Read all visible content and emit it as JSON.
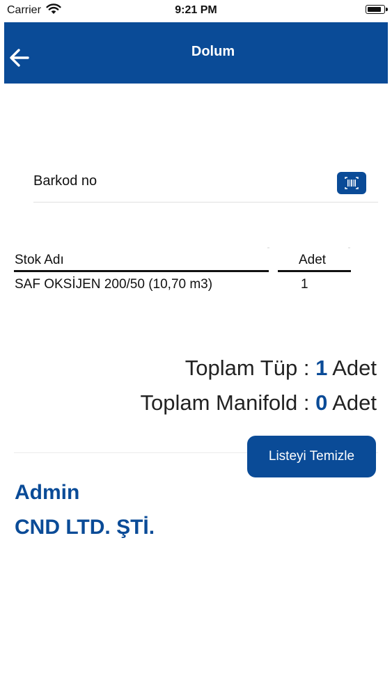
{
  "status_bar": {
    "carrier": "Carrier",
    "time": "9:21 PM",
    "battery_level": 0.9
  },
  "header": {
    "title": "Dolum",
    "back_icon": "arrow-left-icon"
  },
  "barcode": {
    "label": "Barkod no",
    "scan_icon": "barcode-scan-icon"
  },
  "table": {
    "headers": {
      "stock_name": "Stok Adı",
      "quantity": "Adet"
    },
    "rows": [
      {
        "stock_name": "SAF OKSİJEN 200/50 (10,70 m3)",
        "quantity": "1"
      }
    ]
  },
  "totals": {
    "tube_label": "Toplam Tüp :",
    "tube_count": "1",
    "tube_unit": "Adet",
    "manifold_label": "Toplam Manifold :",
    "manifold_count": "0",
    "manifold_unit": "Adet"
  },
  "actions": {
    "clear_list": "Listeyi Temizle"
  },
  "footer": {
    "user": "Admin",
    "company": "CND LTD. ŞTİ."
  },
  "colors": {
    "brand": "#0a4b97",
    "text": "#1a1a1a",
    "background": "#ffffff"
  }
}
